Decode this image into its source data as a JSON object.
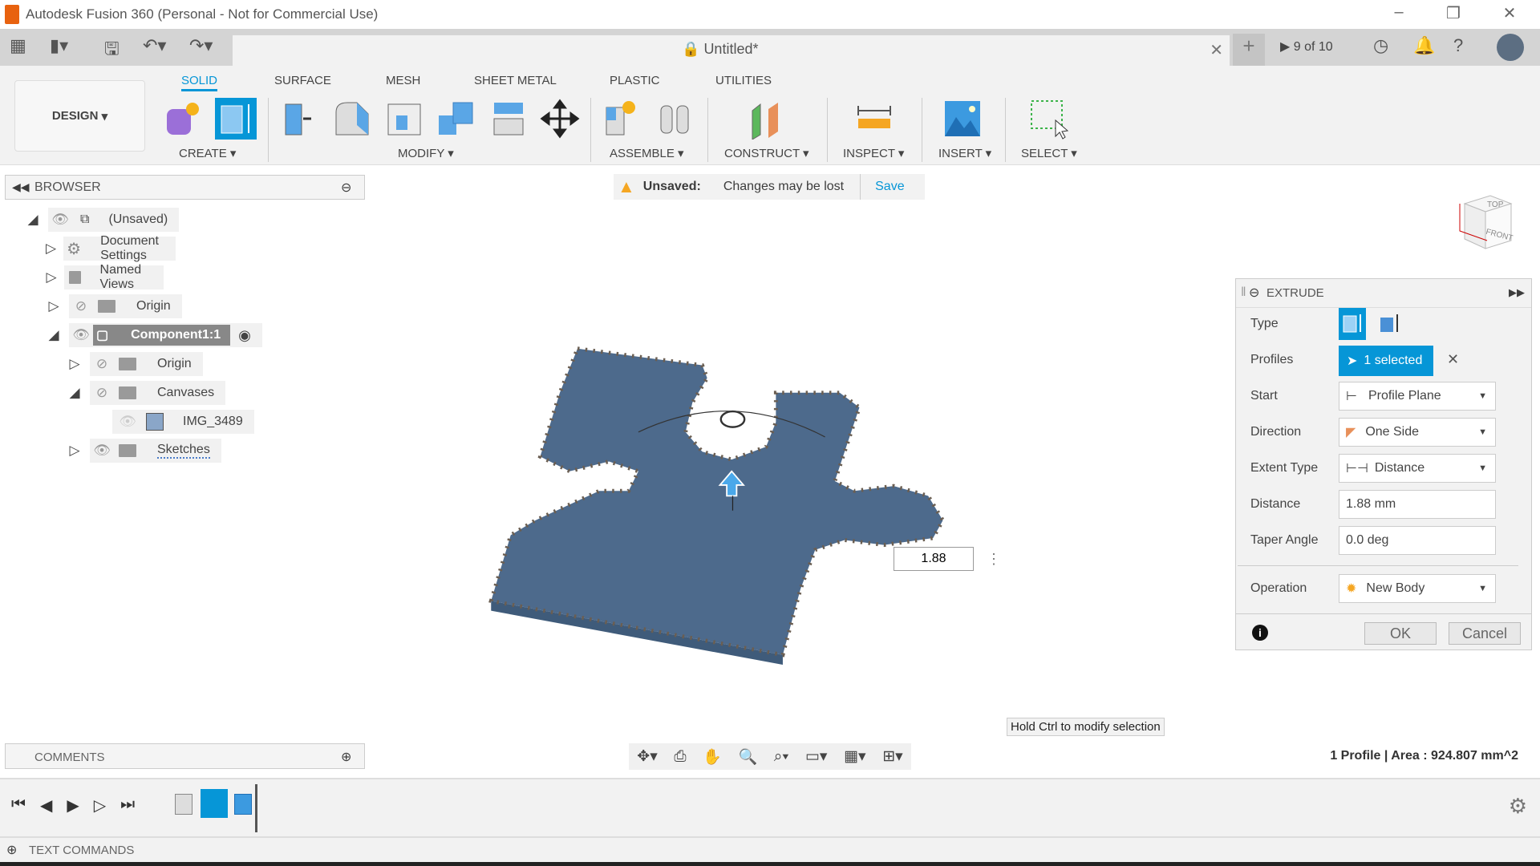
{
  "window": {
    "title": "Autodesk Fusion 360 (Personal - Not for Commercial Use)"
  },
  "tabbar": {
    "doc_title": "Untitled*",
    "job_status": "9 of 10"
  },
  "ribbon": {
    "workspace": "DESIGN",
    "tabs": [
      "SOLID",
      "SURFACE",
      "MESH",
      "SHEET METAL",
      "PLASTIC",
      "UTILITIES"
    ],
    "active_tab": "SOLID",
    "groups": {
      "create": "CREATE",
      "modify": "MODIFY",
      "assemble": "ASSEMBLE",
      "construct": "CONSTRUCT",
      "inspect": "INSPECT",
      "insert": "INSERT",
      "select": "SELECT"
    }
  },
  "browser": {
    "title": "BROWSER",
    "items": [
      {
        "label": "(Unsaved)"
      },
      {
        "label": "Document Settings"
      },
      {
        "label": "Named Views"
      },
      {
        "label": "Origin"
      },
      {
        "label": "Component1:1"
      },
      {
        "label": "Origin"
      },
      {
        "label": "Canvases"
      },
      {
        "label": "IMG_3489"
      },
      {
        "label": "Sketches"
      }
    ]
  },
  "banner": {
    "status": "Unsaved:",
    "message": "Changes may be lost",
    "save": "Save"
  },
  "viewcube": {
    "top": "TOP",
    "front": "FRONT"
  },
  "viewport": {
    "distance_input": "1.88",
    "tooltip": "Hold Ctrl to modify selection",
    "status": "1 Profile | Area : 924.807 mm^2"
  },
  "extrude": {
    "title": "EXTRUDE",
    "labels": {
      "type": "Type",
      "profiles": "Profiles",
      "start": "Start",
      "direction": "Direction",
      "extent": "Extent Type",
      "distance": "Distance",
      "taper": "Taper Angle",
      "operation": "Operation"
    },
    "profiles": "1 selected",
    "start": "Profile Plane",
    "direction": "One Side",
    "extent": "Distance",
    "distance": "1.88 mm",
    "taper": "0.0 deg",
    "operation": "New Body",
    "ok": "OK",
    "cancel": "Cancel"
  },
  "comments": {
    "title": "COMMENTS"
  },
  "textcommands": {
    "title": "TEXT COMMANDS"
  },
  "colors": {
    "accent": "#0696d7",
    "body": "#4a6788"
  }
}
